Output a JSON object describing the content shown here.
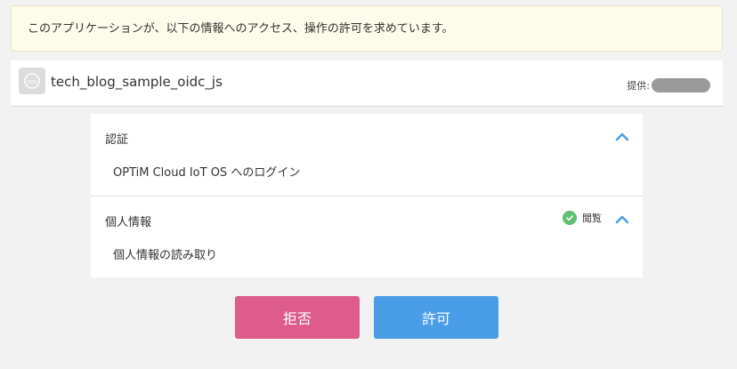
{
  "notice": {
    "text": "このアプリケーションが、以下の情報へのアクセス、操作の許可を求めています。"
  },
  "app": {
    "name": "tech_blog_sample_oidc_js",
    "logo_icon": "app-logo-icon",
    "provider_label": "提供:"
  },
  "scopes": [
    {
      "title": "認証",
      "description": "OPTiM Cloud IoT OS へのログイン",
      "expanded": true,
      "icon": "chevron-up-icon"
    },
    {
      "title": "個人情報",
      "description": "個人情報の読み取り",
      "permission": "閲覧",
      "permission_icon": "check-circle-icon",
      "expanded": true,
      "icon": "chevron-up-icon"
    }
  ],
  "actions": {
    "deny_label": "拒否",
    "allow_label": "許可"
  },
  "colors": {
    "notice_bg": "#fdfbea",
    "accent_blue": "#4a9ee8",
    "deny_pink": "#dd5c8c",
    "check_green": "#5fbf73",
    "page_bg": "#f2f2f2"
  }
}
